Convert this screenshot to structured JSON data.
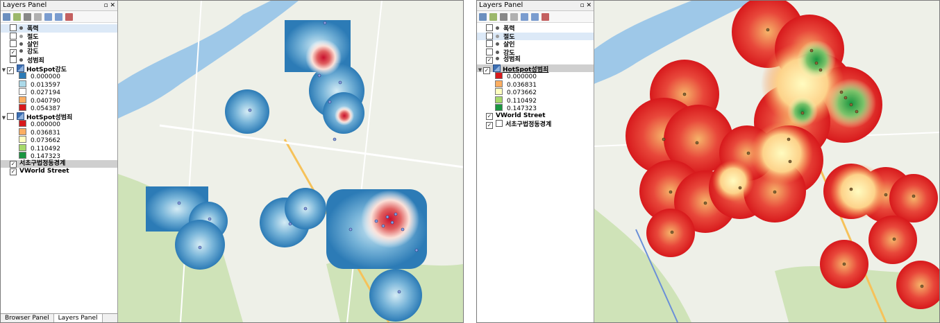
{
  "left": {
    "title": "Layers Panel",
    "title_buttons": "▫ ✕",
    "layers": [
      {
        "label": "폭력",
        "dot": "#5a5a5a",
        "checked": false
      },
      {
        "label": "절도",
        "dot": "#9a9a9a",
        "checked": false
      },
      {
        "label": "살인",
        "dot": "#5a5a5a",
        "checked": false
      },
      {
        "label": "강도",
        "dot": "#5a5a5a",
        "checked": true
      },
      {
        "label": "성범죄",
        "dot": "#5a5a5a",
        "checked": false
      }
    ],
    "hotspot1": {
      "label": "HotSpot강도",
      "checked": true,
      "legend": [
        {
          "value": "0.000000",
          "color": "#2c7bb6"
        },
        {
          "value": "0.013597",
          "color": "#abd9e9"
        },
        {
          "value": "0.027194",
          "color": "#ffffff"
        },
        {
          "value": "0.040790",
          "color": "#fdae61"
        },
        {
          "value": "0.054387",
          "color": "#d7191c"
        }
      ]
    },
    "hotspot2": {
      "label": "HotSpot성범죄",
      "checked": false,
      "legend": [
        {
          "value": "0.000000",
          "color": "#d7191c"
        },
        {
          "value": "0.036831",
          "color": "#fdae61"
        },
        {
          "value": "0.073662",
          "color": "#ffffbf"
        },
        {
          "value": "0.110492",
          "color": "#a6d96a"
        },
        {
          "value": "0.147323",
          "color": "#1a9641"
        }
      ]
    },
    "boundary": {
      "label": "서초구법정동경계",
      "checked": true
    },
    "basemap": {
      "label": "VWorld Street",
      "checked": true
    },
    "tabs": [
      "Browser Panel",
      "Layers Panel"
    ]
  },
  "right": {
    "title": "Layers Panel",
    "title_buttons": "▫ ✕",
    "layers": [
      {
        "label": "폭력",
        "dot": "#5a5a5a",
        "checked": false
      },
      {
        "label": "절도",
        "dot": "#9a9a9a",
        "checked": false
      },
      {
        "label": "살인",
        "dot": "#5a5a5a",
        "checked": false
      },
      {
        "label": "강도",
        "dot": "#5a5a5a",
        "checked": false
      },
      {
        "label": "성범죄",
        "dot": "#5a5a5a",
        "checked": true
      }
    ],
    "hotspot": {
      "label": "HotSpot성범죄",
      "checked": true,
      "legend": [
        {
          "value": "0.000000",
          "color": "#d7191c"
        },
        {
          "value": "0.036831",
          "color": "#fdae61"
        },
        {
          "value": "0.073662",
          "color": "#ffffbf"
        },
        {
          "value": "0.110492",
          "color": "#a6d96a"
        },
        {
          "value": "0.147323",
          "color": "#1a9641"
        }
      ]
    },
    "basemap": {
      "label": "VWorld Street",
      "checked": true
    },
    "boundary": {
      "label": "서초구법정동경계",
      "checked": false
    }
  }
}
